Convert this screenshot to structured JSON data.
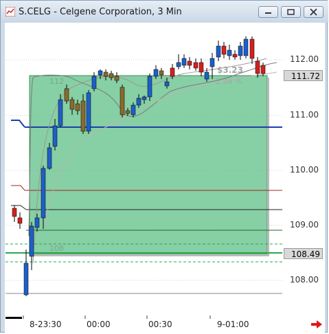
{
  "window": {
    "title": "S.CELG - Celgene Corporation, 3 Min",
    "icon": "chart-app-icon",
    "buttons": [
      "minimize-icon",
      "restore-icon",
      "close-icon"
    ]
  },
  "price_axis": {
    "labels": [
      "112.00",
      "111.00",
      "110.00",
      "109.00",
      "108.00"
    ],
    "current_price": "111.72",
    "entry_price": "108.49"
  },
  "time_axis": {
    "labels": [
      "8-23:30",
      "00:00",
      "00:30",
      "9-01:00"
    ]
  },
  "trade_box": {
    "upper_label": "112",
    "lower_label": "108",
    "gain": "$3.23",
    "gain_percent": "2.98 %",
    "fill_color": "#5fbf85",
    "border_color": "#3d8f5d"
  },
  "colors": {
    "up_candle": "#1e5fc9",
    "down_candle": "#d42020",
    "neutral_candle": "#8b6a2e",
    "blue_line": "#1a3faa",
    "red_line": "#a02424"
  },
  "nav": {
    "next_icon": "right-arrow-icon"
  }
}
